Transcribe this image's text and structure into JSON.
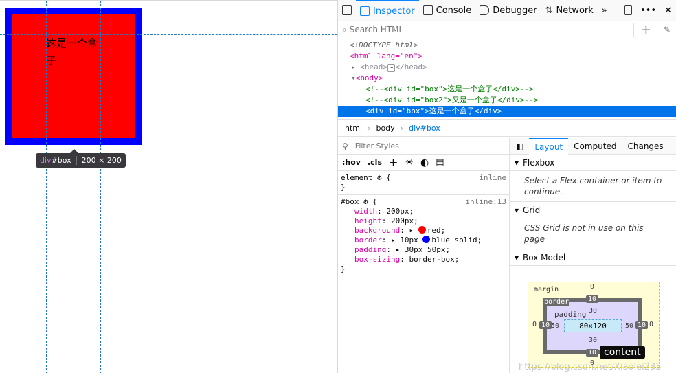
{
  "page": {
    "box_text": "这是一个盒子",
    "infobar": {
      "tag": "div",
      "id": "#box",
      "dims": "200 × 200"
    }
  },
  "toolbar": {
    "tabs": [
      {
        "label": "Inspector"
      },
      {
        "label": "Console"
      },
      {
        "label": "Debugger"
      },
      {
        "label": "Network"
      }
    ]
  },
  "search": {
    "placeholder": "Search HTML"
  },
  "tree": {
    "doctype": "<!DOCTYPE html>",
    "html_open": "<html lang=\"en\">",
    "head": "<head>",
    "head_close": "</head>",
    "body": "<body>",
    "comment1": "<!--<div id=\"box\">这是一个盒子</div>-->",
    "comment2": "<!--<div id=\"box2\">又是一个盒子</div>-->",
    "selected": "<div id=\"box\">这是一个盒子</div>"
  },
  "breadcrumbs": [
    "html",
    "body",
    "div#box"
  ],
  "rules": {
    "filter_placeholder": "Filter Styles",
    "hov": ":hov",
    "cls": ".cls",
    "element_sel": "element",
    "element_src": "inline",
    "box_sel": "#box",
    "box_src": "inline:13",
    "decls": [
      {
        "p": "width",
        "v": "200px"
      },
      {
        "p": "height",
        "v": "200px"
      },
      {
        "p": "background",
        "v": "red"
      },
      {
        "p": "border",
        "v": "10px",
        "v2": "blue solid"
      },
      {
        "p": "padding",
        "v": "30px 50px"
      },
      {
        "p": "box-sizing",
        "v": "border-box"
      }
    ]
  },
  "side": {
    "tabs": [
      "Layout",
      "Computed",
      "Changes"
    ],
    "flexbox": "Flexbox",
    "flex_note": "Select a Flex container or item to continue.",
    "grid": "Grid",
    "grid_note": "CSS Grid is not in use on this page",
    "boxmodel": "Box Model",
    "margin": "margin",
    "border": "border",
    "padding": "padding",
    "content": "80×120",
    "m": "0",
    "b": "10",
    "p_tb": "30",
    "p_lr": "50",
    "tooltip": "content",
    "watermark": "https://blog.csdn.net/Xiaolei233"
  },
  "colors": {
    "red": "#ff0000",
    "blue": "#0000ff",
    "accent": "#0a84ff"
  }
}
